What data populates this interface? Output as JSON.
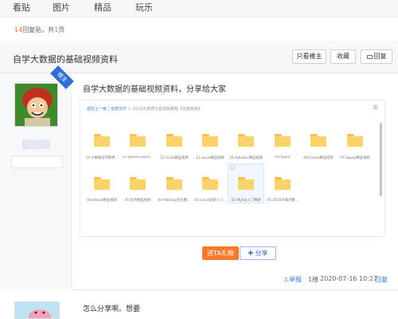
{
  "topnav": {
    "items": [
      "看贴",
      "图片",
      "精品",
      "玩乐"
    ]
  },
  "subbar": {
    "reply_count": "14",
    "reply_label": "回复贴，共",
    "page_count": "1",
    "page_label": "页"
  },
  "thread": {
    "title": "自学大数据的基础视频资料",
    "btn_only_op": "只看楼主",
    "btn_favorite": "收藏",
    "btn_reply": "回复"
  },
  "post1": {
    "badge": "楼主",
    "text": "自学大数据的基础视频资料，分享给大家",
    "explorer": {
      "crumb_back": "返回上一级",
      "crumb_all": "全部文件",
      "crumb_path": "2019大数据全套视频教程【完整免费】",
      "folders_row1": [
        "14.大数据前夸教界...",
        "13.SparkGraphx...",
        "12.Scala精品视频",
        "11.azure精品视频",
        "10.Azkaban精品视频",
        "09.Spark",
        "08.Flume精品视频",
        "07.Sqoop精品视频"
      ],
      "folders_row2": [
        "06.Hbase精品视频",
        "05.綜合精品视频",
        "04.Hadoop生态圈...",
        "03.Linux快速入门...",
        "02.MySql入门精讲",
        "01.2019千锋大数..."
      ]
    },
    "gift_btn": "送TA礼物",
    "share_btn": "分享",
    "share_icon": "plus-icon",
    "report": "举报",
    "floor": "1楼",
    "time": "2020-07-16 10:27",
    "reply": "回复"
  },
  "post2": {
    "text": "怎么分享啊。想要"
  }
}
